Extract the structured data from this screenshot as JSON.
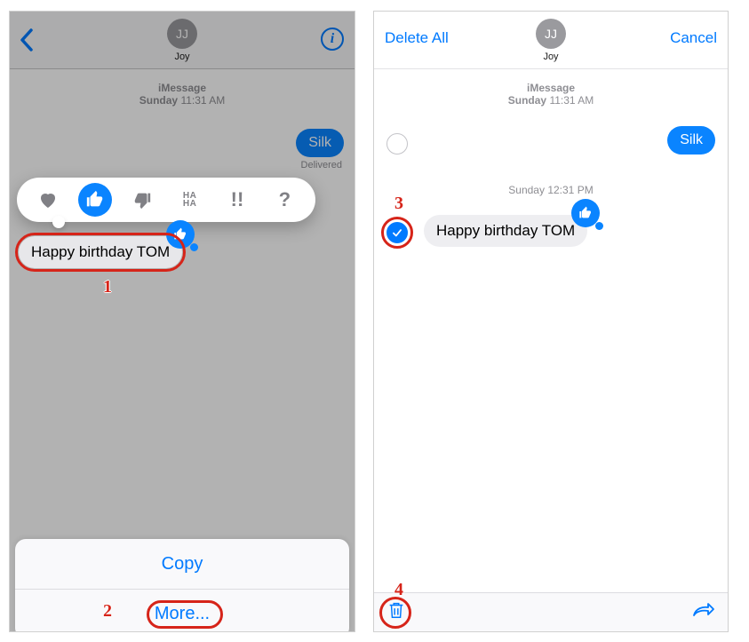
{
  "left": {
    "header": {
      "avatar_initials": "JJ",
      "contact_name": "Joy"
    },
    "datestamp": {
      "service": "iMessage",
      "day": "Sunday",
      "time": "11:31 AM"
    },
    "outgoing": {
      "text": "Silk",
      "status": "Delivered"
    },
    "incoming": {
      "text": "Happy birthday TOM"
    },
    "tapbacks": {
      "heart": "heart",
      "thumbs_up": "thumbs-up",
      "thumbs_down": "thumbs-down",
      "haha": "HA HA",
      "exclaim": "!!",
      "question": "?"
    },
    "sheet": {
      "copy": "Copy",
      "more": "More..."
    },
    "callouts": {
      "c1": "1",
      "c2": "2"
    }
  },
  "right": {
    "header": {
      "delete_all": "Delete All",
      "cancel": "Cancel",
      "avatar_initials": "JJ",
      "contact_name": "Joy"
    },
    "datestamp1": {
      "service": "iMessage",
      "day": "Sunday",
      "time": "11:31 AM"
    },
    "outgoing": {
      "text": "Silk"
    },
    "datestamp2": {
      "day": "Sunday",
      "time": "12:31 PM"
    },
    "incoming": {
      "text": "Happy birthday TOM"
    },
    "callouts": {
      "c3": "3",
      "c4": "4"
    }
  }
}
